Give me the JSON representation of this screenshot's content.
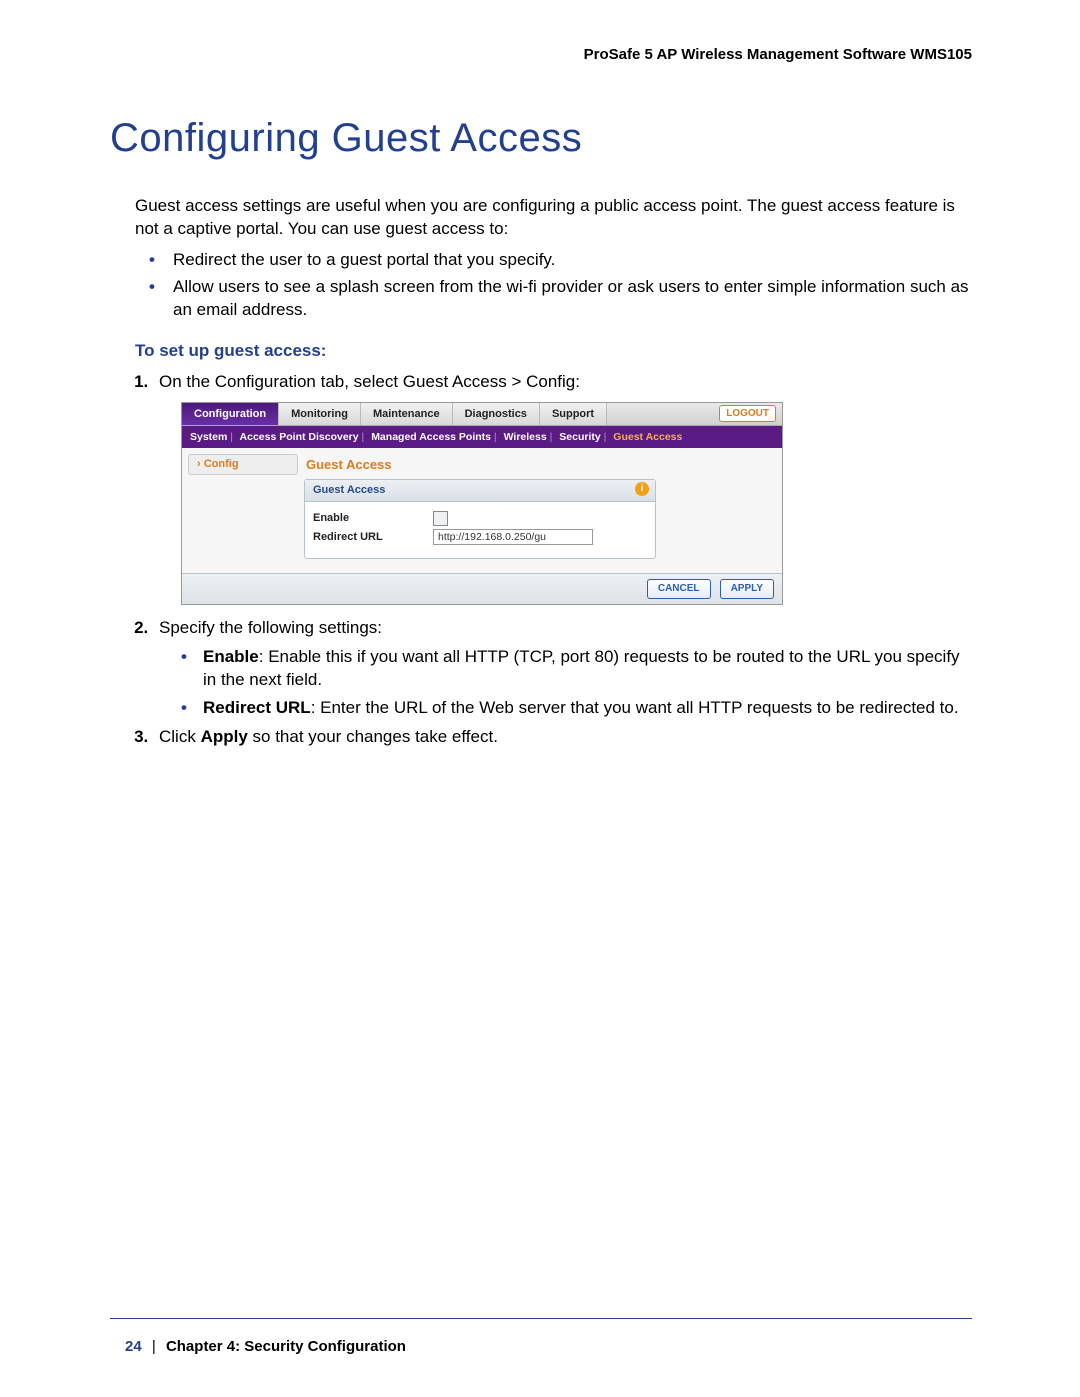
{
  "header": {
    "product": "ProSafe 5 AP Wireless Management Software WMS105"
  },
  "footer": {
    "page": "24",
    "chapter": "Chapter 4:  Security Configuration"
  },
  "title": "Configuring Guest Access",
  "intro": "Guest access settings are useful when you are configuring a public access point. The guest access feature is not a captive portal. You can use guest access to:",
  "intro_bullets": [
    "Redirect the user to a guest portal that you specify.",
    "Allow users to see a splash screen from the wi-fi provider or ask users to enter simple information such as an email address."
  ],
  "subhead": "To set up guest access:",
  "step1": "On the Configuration tab, select Guest Access > Config:",
  "step2_lead": "Specify the following settings:",
  "step2_items": {
    "enable_label": "Enable",
    "enable_desc": ": Enable this if you want all HTTP (TCP, port 80) requests to be routed to the URL you specify in the next field.",
    "url_label": "Redirect URL",
    "url_desc": ": Enter the URL of the Web server that you want all HTTP requests to be redirected to."
  },
  "step3_pre": "Click ",
  "step3_bold": "Apply",
  "step3_post": " so that your changes take effect.",
  "shot": {
    "tabs": [
      "Configuration",
      "Monitoring",
      "Maintenance",
      "Diagnostics",
      "Support"
    ],
    "logout": "LOGOUT",
    "subtabs": [
      "System",
      "Access Point Discovery",
      "Managed Access Points",
      "Wireless",
      "Security",
      "Guest Access"
    ],
    "sidebar_item": "Config",
    "panel_title": "Guest Access",
    "box_title": "Guest Access",
    "fields": {
      "enable": "Enable",
      "redirect": "Redirect URL",
      "redirect_value": "http://192.168.0.250/gu"
    },
    "buttons": {
      "cancel": "CANCEL",
      "apply": "APPLY"
    },
    "info_glyph": "i"
  }
}
